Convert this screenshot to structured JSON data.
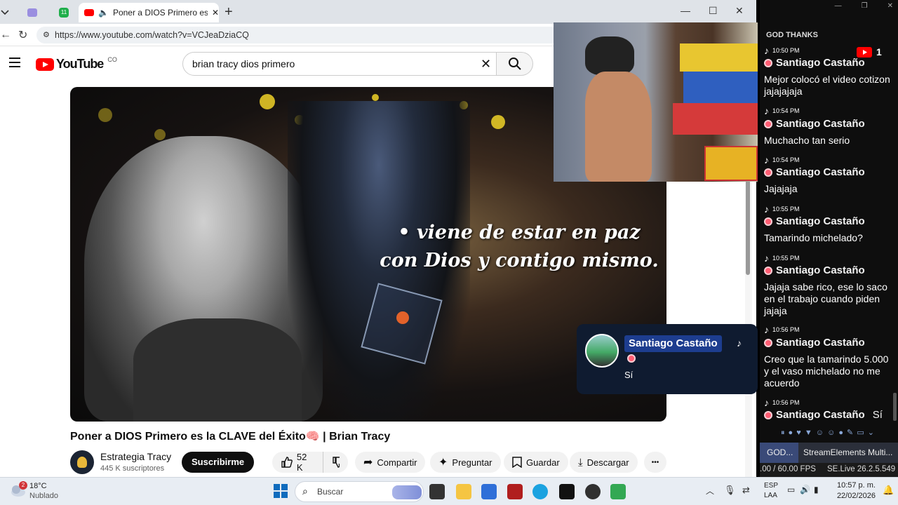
{
  "browser": {
    "tabs": [
      {
        "label": ""
      },
      {
        "label": ""
      },
      {
        "label": "Poner a DIOS Primero es la CL"
      }
    ],
    "new_tab_symbol": "+",
    "url": "https://www.youtube.com/watch?v=VCJeaDziaCQ",
    "window_controls": [
      "—",
      "☐",
      "✕"
    ]
  },
  "youtube": {
    "logo_text": "YouTube",
    "logo_region": "CO",
    "search_value": "brian tracy dios primero",
    "video_caption_line1": "• viene de estar en paz",
    "video_caption_line2": "con Dios y contigo mismo.",
    "video_title": "Poner a DIOS Primero es la CLAVE del Éxito🧠 | Brian Tracy",
    "channel_name": "Estrategia Tracy",
    "subscribers": "445 K suscriptores",
    "subscribe_label": "Suscribirme",
    "likes": "52 K",
    "share_label": "Compartir",
    "ask_label": "Preguntar",
    "save_label": "Guardar",
    "download_label": "Descargar",
    "more_label": "•••"
  },
  "chat": {
    "title": "GOD THANKS",
    "youtube_viewers": "1",
    "messages": [
      {
        "time": "10:50 PM",
        "user": "Santiago Castaño",
        "text": "Mejor colocó el video cotizon jajajajaja"
      },
      {
        "time": "10:54 PM",
        "user": "Santiago Castaño",
        "text": "Muchacho tan serio"
      },
      {
        "time": "10:54 PM",
        "user": "Santiago Castaño",
        "text": "Jajajaja"
      },
      {
        "time": "10:55 PM",
        "user": "Santiago Castaño",
        "text": "Tamarindo michelado?"
      },
      {
        "time": "10:55 PM",
        "user": "Santiago Castaño",
        "text": "Jajaja sabe rico, ese lo saco en el trabajo cuando piden jajaja"
      },
      {
        "time": "10:56 PM",
        "user": "Santiago Castaño",
        "text": "Creo que la tamarindo 5.000 y el vaso michelado no me acuerdo"
      },
      {
        "time": "10:56 PM",
        "user": "Santiago Castaño",
        "text": "Sí"
      }
    ],
    "popup_user": "Santiago Castaño",
    "popup_text": "Sí",
    "obs_tab1": "GOD...",
    "obs_tab2": "StreamElements Multi...",
    "fps": ".00 / 60.00 FPS",
    "version": "SE.Live 26.2.5.549"
  },
  "taskbar": {
    "weather_temp": "18°C",
    "weather_desc": "Nublado",
    "weather_badge": "2",
    "search_placeholder": "Buscar",
    "lang1": "ESP",
    "lang2": "LAA",
    "time": "10:57 p. m.",
    "date": "22/02/2026"
  }
}
